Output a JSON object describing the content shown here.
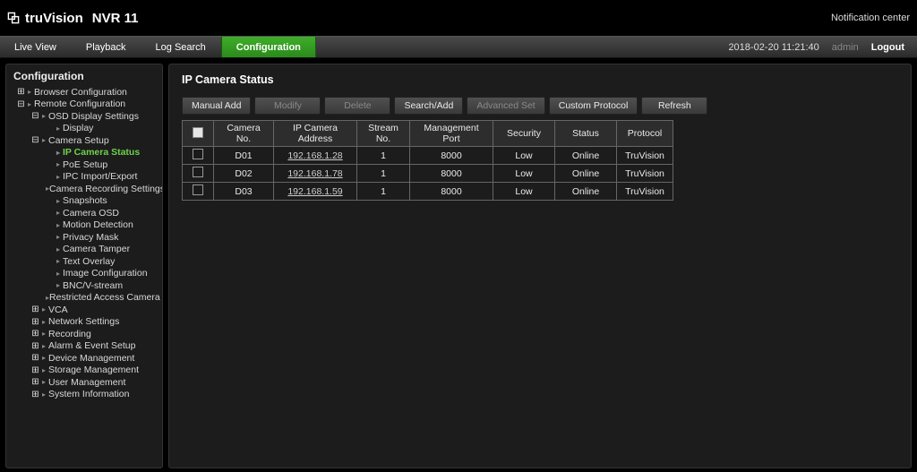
{
  "brand": {
    "name": "truVision",
    "model": "NVR  11"
  },
  "header": {
    "notification": "Notification center"
  },
  "nav": {
    "items": [
      {
        "label": "Live View",
        "active": false
      },
      {
        "label": "Playback",
        "active": false
      },
      {
        "label": "Log Search",
        "active": false
      },
      {
        "label": "Configuration",
        "active": true
      }
    ],
    "datetime": "2018-02-20 11:21:40",
    "user": "admin",
    "logout": "Logout"
  },
  "sidebar": {
    "title": "Configuration",
    "tree": [
      {
        "label": "Browser Configuration",
        "indent": 0,
        "toggle": "+",
        "arrow": true
      },
      {
        "label": "Remote Configuration",
        "indent": 0,
        "toggle": "-",
        "arrow": true
      },
      {
        "label": "OSD Display Settings",
        "indent": 1,
        "toggle": "-",
        "arrow": true
      },
      {
        "label": "Display",
        "indent": 2,
        "toggle": "",
        "arrow": true
      },
      {
        "label": "Camera Setup",
        "indent": 1,
        "toggle": "-",
        "arrow": true
      },
      {
        "label": "IP Camera Status",
        "indent": 2,
        "toggle": "",
        "arrow": true,
        "active": true
      },
      {
        "label": "PoE Setup",
        "indent": 2,
        "toggle": "",
        "arrow": true
      },
      {
        "label": "IPC Import/Export",
        "indent": 2,
        "toggle": "",
        "arrow": true
      },
      {
        "label": "Camera Recording Settings",
        "indent": 2,
        "toggle": "",
        "arrow": true
      },
      {
        "label": "Snapshots",
        "indent": 2,
        "toggle": "",
        "arrow": true
      },
      {
        "label": "Camera OSD",
        "indent": 2,
        "toggle": "",
        "arrow": true
      },
      {
        "label": "Motion Detection",
        "indent": 2,
        "toggle": "",
        "arrow": true
      },
      {
        "label": "Privacy Mask",
        "indent": 2,
        "toggle": "",
        "arrow": true
      },
      {
        "label": "Camera Tamper",
        "indent": 2,
        "toggle": "",
        "arrow": true
      },
      {
        "label": "Text Overlay",
        "indent": 2,
        "toggle": "",
        "arrow": true
      },
      {
        "label": "Image Configuration",
        "indent": 2,
        "toggle": "",
        "arrow": true
      },
      {
        "label": "BNC/V-stream",
        "indent": 2,
        "toggle": "",
        "arrow": true
      },
      {
        "label": "Restricted Access Camera",
        "indent": 2,
        "toggle": "",
        "arrow": true
      },
      {
        "label": "VCA",
        "indent": 1,
        "toggle": "+",
        "arrow": true
      },
      {
        "label": "Network Settings",
        "indent": 1,
        "toggle": "+",
        "arrow": true
      },
      {
        "label": "Recording",
        "indent": 1,
        "toggle": "+",
        "arrow": true
      },
      {
        "label": "Alarm & Event Setup",
        "indent": 1,
        "toggle": "+",
        "arrow": true
      },
      {
        "label": "Device Management",
        "indent": 1,
        "toggle": "+",
        "arrow": true
      },
      {
        "label": "Storage Management",
        "indent": 1,
        "toggle": "+",
        "arrow": true
      },
      {
        "label": "User Management",
        "indent": 1,
        "toggle": "+",
        "arrow": true
      },
      {
        "label": "System Information",
        "indent": 1,
        "toggle": "+",
        "arrow": true
      }
    ]
  },
  "content": {
    "title": "IP Camera Status",
    "toolbar": [
      {
        "label": "Manual Add",
        "disabled": false
      },
      {
        "label": "Modify",
        "disabled": true
      },
      {
        "label": "Delete",
        "disabled": true
      },
      {
        "label": "Search/Add",
        "disabled": false
      },
      {
        "label": "Advanced Set",
        "disabled": true
      },
      {
        "label": "Custom Protocol",
        "disabled": false
      },
      {
        "label": "Refresh",
        "disabled": false
      }
    ],
    "columns": [
      "",
      "Camera No.",
      "IP Camera Address",
      "Stream No.",
      "Management Port",
      "Security",
      "Status",
      "Protocol"
    ],
    "rows": [
      {
        "no": "D01",
        "ip": "192.168.1.28",
        "stream": "1",
        "port": "8000",
        "security": "Low",
        "status": "Online",
        "protocol": "TruVision"
      },
      {
        "no": "D02",
        "ip": "192.168.1.78",
        "stream": "1",
        "port": "8000",
        "security": "Low",
        "status": "Online",
        "protocol": "TruVision"
      },
      {
        "no": "D03",
        "ip": "192.168.1.59",
        "stream": "1",
        "port": "8000",
        "security": "Low",
        "status": "Online",
        "protocol": "TruVision"
      }
    ]
  }
}
